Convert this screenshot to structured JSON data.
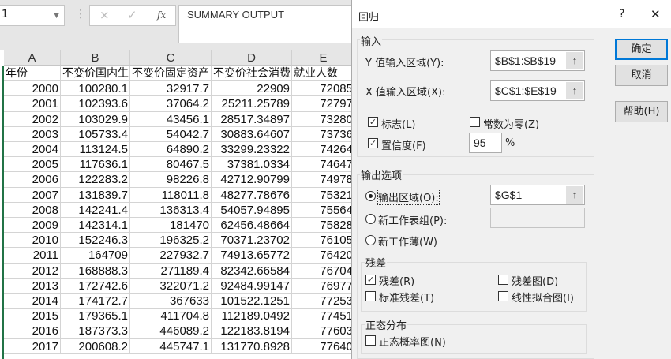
{
  "formula_bar": {
    "name_box": "1",
    "cancel_icon": "×",
    "enter_icon": "✓",
    "fx": "fx",
    "content": "SUMMARY OUTPUT"
  },
  "sheet": {
    "columns": [
      "A",
      "B",
      "C",
      "D",
      "E"
    ],
    "header_row": [
      "年份",
      "不变价国内生",
      "不变价固定资产",
      "不变价社会消费",
      "就业人数"
    ],
    "rows": [
      [
        "2000",
        "100280.1",
        "32917.7",
        "22909",
        "72085"
      ],
      [
        "2001",
        "102393.6",
        "37064.2",
        "25211.25789",
        "72797"
      ],
      [
        "2002",
        "103029.9",
        "43456.1",
        "28517.34897",
        "73280"
      ],
      [
        "2003",
        "105733.4",
        "54042.7",
        "30883.64607",
        "73736"
      ],
      [
        "2004",
        "113124.5",
        "64890.2",
        "33299.23322",
        "74264"
      ],
      [
        "2005",
        "117636.1",
        "80467.5",
        "37381.0334",
        "74647"
      ],
      [
        "2006",
        "122283.2",
        "98226.8",
        "42712.90799",
        "74978"
      ],
      [
        "2007",
        "131839.7",
        "118011.8",
        "48277.78676",
        "75321"
      ],
      [
        "2008",
        "142241.4",
        "136313.4",
        "54057.94895",
        "75564"
      ],
      [
        "2009",
        "142314.1",
        "181470",
        "62456.48664",
        "75828"
      ],
      [
        "2010",
        "152246.3",
        "196325.2",
        "70371.23702",
        "76105"
      ],
      [
        "2011",
        "164709",
        "227932.7",
        "74913.65772",
        "76420"
      ],
      [
        "2012",
        "168888.3",
        "271189.4",
        "82342.66584",
        "76704"
      ],
      [
        "2013",
        "172742.6",
        "322071.2",
        "92484.99147",
        "76977"
      ],
      [
        "2014",
        "174172.7",
        "367633",
        "101522.1251",
        "77253"
      ],
      [
        "2015",
        "179365.1",
        "411704.8",
        "112189.0492",
        "77451"
      ],
      [
        "2016",
        "187373.3",
        "446089.2",
        "122183.8194",
        "77603"
      ],
      [
        "2017",
        "200608.2",
        "445747.1",
        "131770.8928",
        "77640"
      ]
    ]
  },
  "dialog": {
    "title": "回归",
    "help_icon": "?",
    "close_icon": "✕",
    "input_group": "输入",
    "y_label": "Y 值输入区域(Y):",
    "y_value": "$B$1:$B$19",
    "x_label": "X 值输入区域(X):",
    "x_value": "$C$1:$E$19",
    "labels": {
      "label": "标志(L)",
      "checked": true
    },
    "const_zero": {
      "label": "常数为零(Z)",
      "checked": false
    },
    "confidence": {
      "label": "置信度(F)",
      "checked": true,
      "value": "95",
      "unit": "%"
    },
    "output_group": "输出选项",
    "output_range": {
      "label": "输出区域(O):",
      "selected": true,
      "value": "$G$1"
    },
    "new_sheet": {
      "label": "新工作表组(P):",
      "selected": false,
      "value": ""
    },
    "new_book": {
      "label": "新工作薄(W)",
      "selected": false
    },
    "residual_group": "残差",
    "residuals": {
      "label": "残差(R)",
      "checked": true
    },
    "std_residuals": {
      "label": "标准残差(T)",
      "checked": false
    },
    "residual_plot": {
      "label": "残差图(D)",
      "checked": false
    },
    "line_fit": {
      "label": "线性拟合图(I)",
      "checked": false
    },
    "normal_group": "正态分布",
    "normal_plot": {
      "label": "正态概率图(N)",
      "checked": false
    },
    "ok": "确定",
    "cancel": "取消",
    "help": "帮助(H)",
    "ref_icon": "↑",
    "check_mark": "✓"
  }
}
